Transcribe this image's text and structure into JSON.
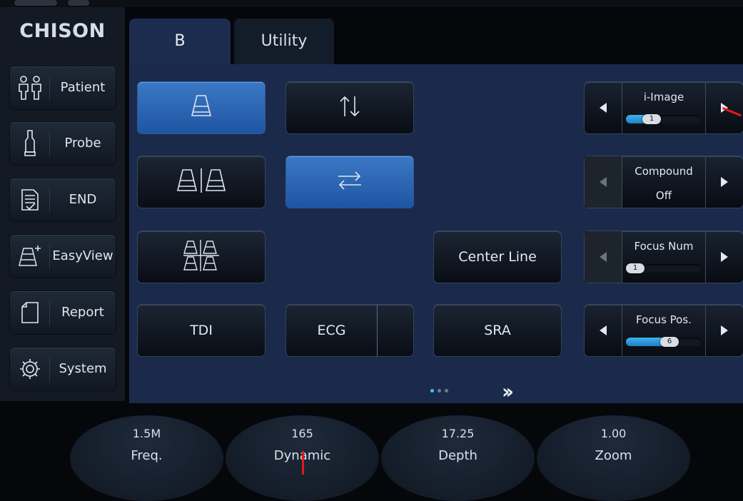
{
  "sidebar": {
    "logo": "CHISON",
    "items": [
      {
        "label": "Patient",
        "icon": "patient-icon"
      },
      {
        "label": "Probe",
        "icon": "probe-icon"
      },
      {
        "label": "END",
        "icon": "end-exam-icon"
      },
      {
        "label": "EasyView",
        "icon": "easyview-icon"
      },
      {
        "label": "Report",
        "icon": "report-icon"
      },
      {
        "label": "System",
        "icon": "system-gear-icon"
      }
    ]
  },
  "tabs": [
    {
      "label": "B",
      "active": true
    },
    {
      "label": "Utility",
      "active": false
    }
  ],
  "buttons": {
    "single_layout": {
      "icon": "single-image-layout-icon",
      "active": true
    },
    "flip_vertical": {
      "icon": "up-down-flip-icon",
      "active": false
    },
    "dual_layout": {
      "icon": "dual-image-layout-icon",
      "active": false
    },
    "flip_horizontal": {
      "icon": "left-right-flip-icon",
      "active": true
    },
    "quad_layout": {
      "icon": "quad-image-layout-icon",
      "active": false
    },
    "center_line": "Center Line",
    "tdi": "TDI",
    "ecg": "ECG",
    "sra": "SRA"
  },
  "controls": {
    "i_image": {
      "label": "i-Image",
      "value": "1",
      "level": 0.22
    },
    "compound": {
      "label": "Compound",
      "value": "Off"
    },
    "focus_num": {
      "label": "Focus Num",
      "value": "1",
      "level": 0.0
    },
    "focus_pos": {
      "label": "Focus Pos.",
      "value": "6",
      "level": 0.45
    }
  },
  "pager": {
    "pages": 3,
    "current": 1
  },
  "knobs": [
    {
      "value": "1.5M",
      "label": "Freq."
    },
    {
      "value": "165",
      "label": "Dynamic"
    },
    {
      "value": "17.25",
      "label": "Depth"
    },
    {
      "value": "1.00",
      "label": "Zoom"
    }
  ],
  "colors": {
    "accent": "#3fb4ee",
    "active_button": "#2b66b3",
    "panel": "#1b2a4b"
  }
}
